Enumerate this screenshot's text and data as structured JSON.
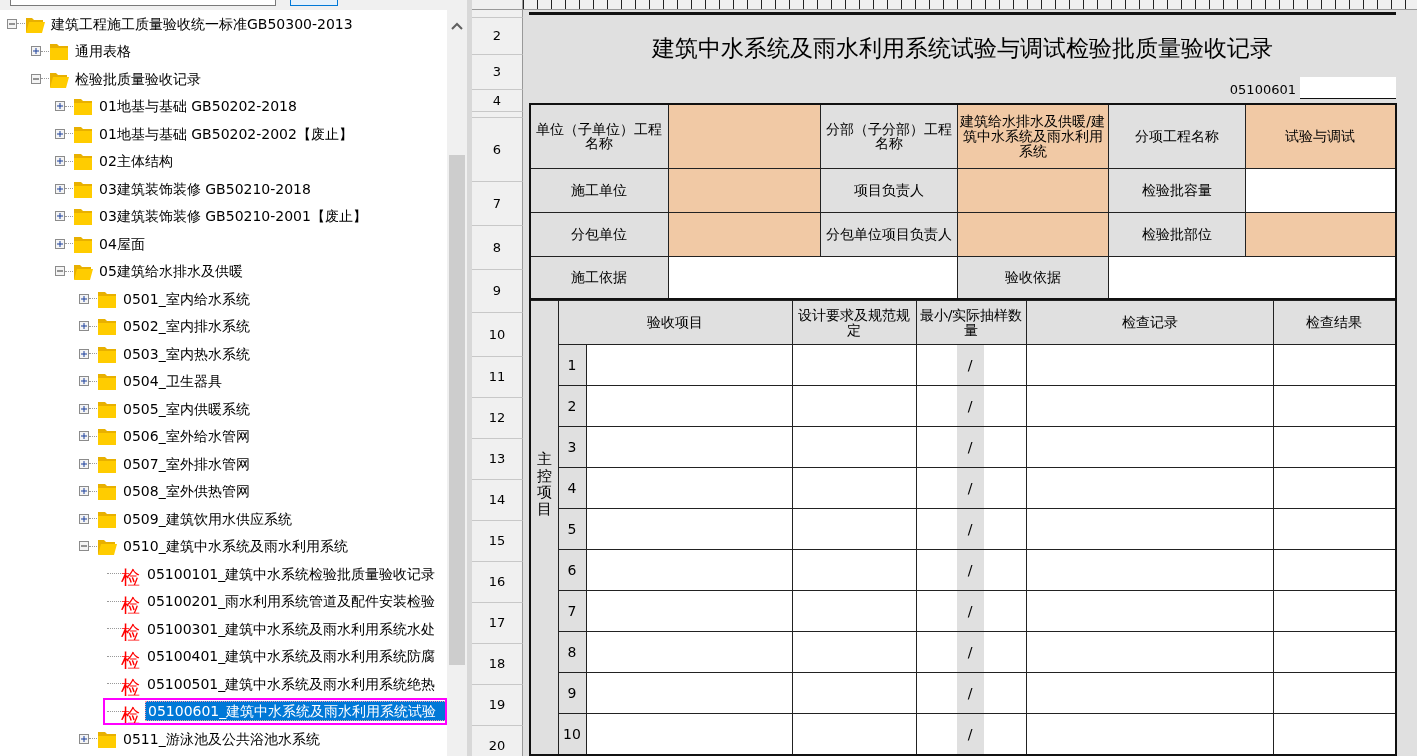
{
  "tree": [
    {
      "label": "建筑工程施工质量验收统一标准GB50300-2013",
      "kind": "folder",
      "expanded": true,
      "selected": false,
      "children": [
        {
          "label": "通用表格",
          "kind": "folder",
          "expanded": false,
          "selected": false
        },
        {
          "label": "检验批质量验收记录",
          "kind": "folder",
          "expanded": true,
          "selected": false,
          "children": [
            {
              "label": "01地基与基础 GB50202-2018",
              "kind": "folder",
              "expanded": false,
              "selected": false
            },
            {
              "label": "01地基与基础 GB50202-2002【废止】",
              "kind": "folder",
              "expanded": false,
              "selected": false
            },
            {
              "label": "02主体结构",
              "kind": "folder",
              "expanded": false,
              "selected": false
            },
            {
              "label": "03建筑装饰装修 GB50210-2018",
              "kind": "folder",
              "expanded": false,
              "selected": false
            },
            {
              "label": "03建筑装饰装修 GB50210-2001【废止】",
              "kind": "folder",
              "expanded": false,
              "selected": false
            },
            {
              "label": "04屋面",
              "kind": "folder",
              "expanded": false,
              "selected": false
            },
            {
              "label": "05建筑给水排水及供暖",
              "kind": "folder",
              "expanded": true,
              "selected": false,
              "children": [
                {
                  "label": "0501_室内给水系统",
                  "kind": "folder",
                  "expanded": false,
                  "selected": false
                },
                {
                  "label": "0502_室内排水系统",
                  "kind": "folder",
                  "expanded": false,
                  "selected": false
                },
                {
                  "label": "0503_室内热水系统",
                  "kind": "folder",
                  "expanded": false,
                  "selected": false
                },
                {
                  "label": "0504_卫生器具",
                  "kind": "folder",
                  "expanded": false,
                  "selected": false
                },
                {
                  "label": "0505_室内供暖系统",
                  "kind": "folder",
                  "expanded": false,
                  "selected": false
                },
                {
                  "label": "0506_室外给水管网",
                  "kind": "folder",
                  "expanded": false,
                  "selected": false
                },
                {
                  "label": "0507_室外排水管网",
                  "kind": "folder",
                  "expanded": false,
                  "selected": false
                },
                {
                  "label": "0508_室外供热管网",
                  "kind": "folder",
                  "expanded": false,
                  "selected": false
                },
                {
                  "label": "0509_建筑饮用水供应系统",
                  "kind": "folder",
                  "expanded": false,
                  "selected": false
                },
                {
                  "label": "0510_建筑中水系统及雨水利用系统",
                  "kind": "folder",
                  "expanded": true,
                  "selected": false,
                  "children": [
                    {
                      "label": "05100101_建筑中水系统检验批质量验收记录",
                      "kind": "record",
                      "badge": "检",
                      "selected": false
                    },
                    {
                      "label": "05100201_雨水利用系统管道及配件安装检验",
                      "kind": "record",
                      "badge": "检",
                      "selected": false
                    },
                    {
                      "label": "05100301_建筑中水系统及雨水利用系统水处",
                      "kind": "record",
                      "badge": "检",
                      "selected": false
                    },
                    {
                      "label": "05100401_建筑中水系统及雨水利用系统防腐",
                      "kind": "record",
                      "badge": "检",
                      "selected": false
                    },
                    {
                      "label": "05100501_建筑中水系统及雨水利用系统绝热",
                      "kind": "record",
                      "badge": "检",
                      "selected": false
                    },
                    {
                      "label": "05100601_建筑中水系统及雨水利用系统试验",
                      "kind": "record",
                      "badge": "检",
                      "selected": true
                    }
                  ]
                },
                {
                  "label": "0511_游泳池及公共浴池水系统",
                  "kind": "folder",
                  "expanded": false,
                  "selected": false
                }
              ]
            }
          ]
        }
      ]
    }
  ],
  "sheet": {
    "row_numbers": [
      "2",
      "3",
      "4",
      "6",
      "7",
      "8",
      "9",
      "10",
      "11",
      "12",
      "13",
      "14",
      "15",
      "16",
      "17",
      "18",
      "19",
      "20"
    ],
    "title": "建筑中水系统及雨水利用系统试验与调试检验批质量验收记录",
    "code": "05100601",
    "info_rows": [
      [
        {
          "kind": "label",
          "text": "单位（子单位）工程名称"
        },
        {
          "kind": "input"
        },
        {
          "kind": "label",
          "text": "分部（子分部）工程名称"
        },
        {
          "kind": "input",
          "text": "建筑给水排水及供暖/建筑中水系统及雨水利用系统"
        },
        {
          "kind": "label",
          "text": "分项工程名称"
        },
        {
          "kind": "input",
          "text": "试验与调试"
        }
      ],
      [
        {
          "kind": "label",
          "text": "施工单位"
        },
        {
          "kind": "input"
        },
        {
          "kind": "label",
          "text": "项目负责人"
        },
        {
          "kind": "input"
        },
        {
          "kind": "label",
          "text": "检验批容量"
        },
        {
          "kind": "blank"
        }
      ],
      [
        {
          "kind": "label",
          "text": "分包单位"
        },
        {
          "kind": "input"
        },
        {
          "kind": "label",
          "text": "分包单位项目负责人"
        },
        {
          "kind": "input"
        },
        {
          "kind": "label",
          "text": "检验批部位"
        },
        {
          "kind": "input"
        }
      ],
      [
        {
          "kind": "label",
          "text": "施工依据"
        },
        {
          "kind": "wide_blank"
        },
        {
          "kind": "label",
          "text": "验收依据"
        },
        {
          "kind": "wide_blank"
        }
      ]
    ],
    "checklist": {
      "section": "主控项目",
      "headers": [
        "验收项目",
        "设计要求及规范规定",
        "最小/实际抽样数量",
        "检查记录",
        "检查结果"
      ],
      "rows": [
        {
          "no": "1",
          "sample": "/"
        },
        {
          "no": "2",
          "sample": "/"
        },
        {
          "no": "3",
          "sample": "/"
        },
        {
          "no": "4",
          "sample": "/"
        },
        {
          "no": "5",
          "sample": "/"
        },
        {
          "no": "6",
          "sample": "/"
        },
        {
          "no": "7",
          "sample": "/"
        },
        {
          "no": "8",
          "sample": "/"
        },
        {
          "no": "9",
          "sample": "/"
        },
        {
          "no": "10",
          "sample": "/"
        }
      ]
    }
  }
}
